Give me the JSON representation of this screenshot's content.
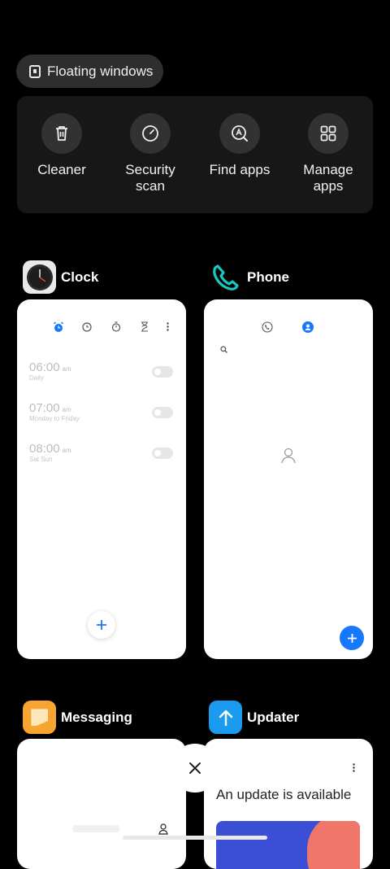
{
  "floating": {
    "label": "Floating windows"
  },
  "tools": [
    {
      "label": "Cleaner",
      "icon": "trash-icon"
    },
    {
      "label": "Security\nscan",
      "icon": "security-scan-icon"
    },
    {
      "label": "Find apps",
      "icon": "find-apps-icon"
    },
    {
      "label": "Manage\napps",
      "icon": "grid-icon"
    }
  ],
  "apps": {
    "clock": {
      "name": "Clock",
      "alarms": [
        {
          "time": "06:00",
          "ampm": "am",
          "repeat": "Daily"
        },
        {
          "time": "07:00",
          "ampm": "am",
          "repeat": "Monday to Friday"
        },
        {
          "time": "08:00",
          "ampm": "am",
          "repeat": "Sat Sun"
        }
      ]
    },
    "phone": {
      "name": "Phone"
    },
    "messaging": {
      "name": "Messaging"
    },
    "updater": {
      "name": "Updater",
      "message": "An update is available"
    }
  },
  "colors": {
    "accent": "#1677ff",
    "phone_teal": "#19c8c0",
    "messaging_orange": "#f7a530",
    "updater_blue": "#1a9bf0"
  }
}
